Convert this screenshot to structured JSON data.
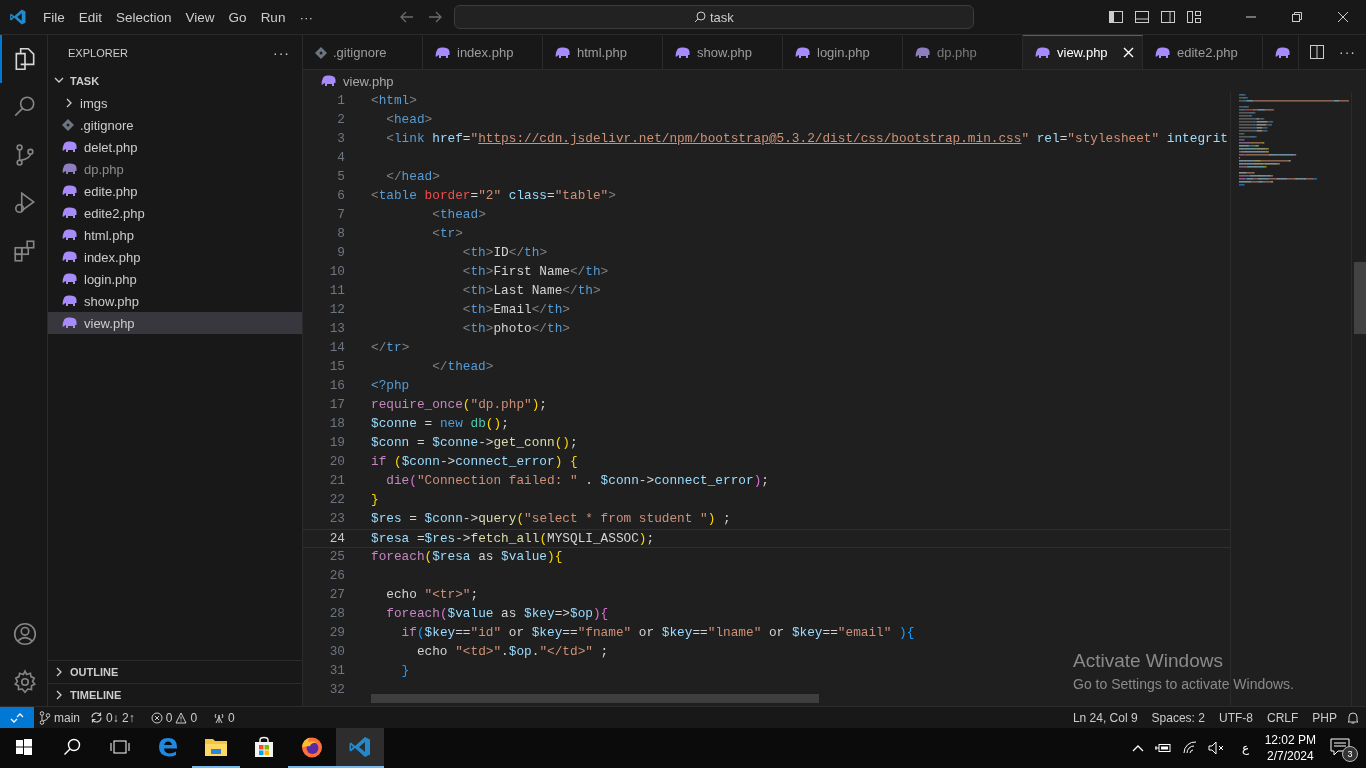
{
  "title_bar": {
    "menu": [
      "File",
      "Edit",
      "Selection",
      "View",
      "Go",
      "Run",
      "···"
    ],
    "search": {
      "value": "task"
    }
  },
  "activity_bar": {
    "top": [
      {
        "kind": "files",
        "selected": true
      },
      {
        "kind": "search",
        "selected": false
      },
      {
        "kind": "source-control",
        "selected": false
      },
      {
        "kind": "run-debug",
        "selected": false
      },
      {
        "kind": "extensions",
        "selected": false
      }
    ],
    "bottom": [
      {
        "kind": "account",
        "selected": false
      },
      {
        "kind": "gear",
        "selected": false
      }
    ]
  },
  "explorer": {
    "title": "EXPLORER",
    "more": "···",
    "folder": "TASK",
    "expanded": true,
    "files": [
      {
        "kind": "folder",
        "name": "imgs",
        "dimmed": false,
        "selected": false
      },
      {
        "kind": "gitignore",
        "name": ".gitignore",
        "dimmed": false,
        "selected": false
      },
      {
        "kind": "php",
        "name": "delet.php",
        "dimmed": false,
        "selected": false
      },
      {
        "kind": "php",
        "name": "dp.php",
        "dimmed": true,
        "selected": false
      },
      {
        "kind": "php",
        "name": "edite.php",
        "dimmed": false,
        "selected": false
      },
      {
        "kind": "php",
        "name": "edite2.php",
        "dimmed": false,
        "selected": false
      },
      {
        "kind": "php",
        "name": "html.php",
        "dimmed": false,
        "selected": false
      },
      {
        "kind": "php",
        "name": "index.php",
        "dimmed": false,
        "selected": false
      },
      {
        "kind": "php",
        "name": "login.php",
        "dimmed": false,
        "selected": false
      },
      {
        "kind": "php",
        "name": "show.php",
        "dimmed": false,
        "selected": false
      },
      {
        "kind": "php",
        "name": "view.php",
        "dimmed": false,
        "selected": true
      }
    ],
    "sections": [
      "OUTLINE",
      "TIMELINE"
    ]
  },
  "tabs": [
    {
      "kind": "gitignore",
      "label": ".gitignore",
      "dimmed": false,
      "selected": false
    },
    {
      "kind": "php",
      "label": "index.php",
      "dimmed": false,
      "selected": false
    },
    {
      "kind": "php",
      "label": "html.php",
      "dimmed": false,
      "selected": false
    },
    {
      "kind": "php",
      "label": "show.php",
      "dimmed": false,
      "selected": false
    },
    {
      "kind": "php",
      "label": "login.php",
      "dimmed": false,
      "selected": false
    },
    {
      "kind": "php",
      "label": "dp.php",
      "dimmed": true,
      "selected": false
    },
    {
      "kind": "php",
      "label": "view.php",
      "dimmed": false,
      "selected": true
    },
    {
      "kind": "php",
      "label": "edite2.php",
      "dimmed": false,
      "selected": false
    },
    {
      "kind": "php",
      "dimmed": false,
      "selected": false
    }
  ],
  "breadcrumb": "view.php",
  "editor": {
    "lines": [
      {
        "number": "1",
        "current": false,
        "tokens": [
          {
            "kind": "punct",
            "text": "<"
          },
          {
            "kind": "tag",
            "text": "html"
          },
          {
            "kind": "punct",
            "text": ">"
          }
        ]
      },
      {
        "number": "2",
        "current": false,
        "tokens": [
          {
            "kind": "punct",
            "text": "  <"
          },
          {
            "kind": "tag",
            "text": "head"
          },
          {
            "kind": "punct",
            "text": ">"
          }
        ]
      },
      {
        "number": "3",
        "current": false,
        "tokens": [
          {
            "kind": "punct",
            "text": "  <"
          },
          {
            "kind": "tag",
            "text": "link"
          },
          {
            "kind": "attr",
            "text": " href"
          },
          {
            "kind": "text",
            "text": "="
          },
          {
            "kind": "str",
            "text": "\""
          },
          {
            "kind": "link",
            "text": "https://cdn.jsdelivr.net/npm/bootstrap@5.3.2/dist/css/bootstrap.min.css"
          },
          {
            "kind": "str",
            "text": "\""
          },
          {
            "kind": "attr",
            "text": " rel"
          },
          {
            "kind": "text",
            "text": "="
          },
          {
            "kind": "str",
            "text": "\"stylesheet\""
          },
          {
            "kind": "attr",
            "text": " integrit"
          }
        ]
      },
      {
        "number": "4",
        "current": false
      },
      {
        "number": "5",
        "current": false,
        "tokens": [
          {
            "kind": "punct",
            "text": "  </"
          },
          {
            "kind": "tag",
            "text": "head"
          },
          {
            "kind": "punct",
            "text": ">"
          }
        ]
      },
      {
        "number": "6",
        "current": false,
        "tokens": [
          {
            "kind": "punct",
            "text": "<"
          },
          {
            "kind": "tag",
            "text": "table"
          },
          {
            "kind": "attrred",
            "text": " border"
          },
          {
            "kind": "text",
            "text": "="
          },
          {
            "kind": "str",
            "text": "\"2\""
          },
          {
            "kind": "attr",
            "text": " class"
          },
          {
            "kind": "text",
            "text": "="
          },
          {
            "kind": "str",
            "text": "\"table\""
          },
          {
            "kind": "punct",
            "text": ">"
          }
        ]
      },
      {
        "number": "7",
        "current": false,
        "tokens": [
          {
            "kind": "punct",
            "text": "        <"
          },
          {
            "kind": "tag",
            "text": "thead"
          },
          {
            "kind": "punct",
            "text": ">"
          }
        ]
      },
      {
        "number": "8",
        "current": false,
        "tokens": [
          {
            "kind": "punct",
            "text": "        <"
          },
          {
            "kind": "tag",
            "text": "tr"
          },
          {
            "kind": "punct",
            "text": ">"
          }
        ]
      },
      {
        "number": "9",
        "current": false,
        "tokens": [
          {
            "kind": "punct",
            "text": "            <"
          },
          {
            "kind": "tag",
            "text": "th"
          },
          {
            "kind": "punct",
            "text": ">"
          },
          {
            "kind": "text",
            "text": "ID"
          },
          {
            "kind": "punct",
            "text": "</"
          },
          {
            "kind": "tag",
            "text": "th"
          },
          {
            "kind": "punct",
            "text": ">"
          }
        ]
      },
      {
        "number": "10",
        "current": false,
        "tokens": [
          {
            "kind": "punct",
            "text": "            <"
          },
          {
            "kind": "tag",
            "text": "th"
          },
          {
            "kind": "punct",
            "text": ">"
          },
          {
            "kind": "text",
            "text": "First Name"
          },
          {
            "kind": "punct",
            "text": "</"
          },
          {
            "kind": "tag",
            "text": "th"
          },
          {
            "kind": "punct",
            "text": ">"
          }
        ]
      },
      {
        "number": "11",
        "current": false,
        "tokens": [
          {
            "kind": "punct",
            "text": "            <"
          },
          {
            "kind": "tag",
            "text": "th"
          },
          {
            "kind": "punct",
            "text": ">"
          },
          {
            "kind": "text",
            "text": "Last Name"
          },
          {
            "kind": "punct",
            "text": "</"
          },
          {
            "kind": "tag",
            "text": "th"
          },
          {
            "kind": "punct",
            "text": ">"
          }
        ]
      },
      {
        "number": "12",
        "current": false,
        "tokens": [
          {
            "kind": "punct",
            "text": "            <"
          },
          {
            "kind": "tag",
            "text": "th"
          },
          {
            "kind": "punct",
            "text": ">"
          },
          {
            "kind": "text",
            "text": "Email"
          },
          {
            "kind": "punct",
            "text": "</"
          },
          {
            "kind": "tag",
            "text": "th"
          },
          {
            "kind": "punct",
            "text": ">"
          }
        ]
      },
      {
        "number": "13",
        "current": false,
        "tokens": [
          {
            "kind": "punct",
            "text": "            <"
          },
          {
            "kind": "tag",
            "text": "th"
          },
          {
            "kind": "punct",
            "text": ">"
          },
          {
            "kind": "text",
            "text": "photo"
          },
          {
            "kind": "punct",
            "text": "</"
          },
          {
            "kind": "tag",
            "text": "th"
          },
          {
            "kind": "punct",
            "text": ">"
          }
        ]
      },
      {
        "number": "14",
        "current": false,
        "tokens": [
          {
            "kind": "punct",
            "text": "</"
          },
          {
            "kind": "tag",
            "text": "tr"
          },
          {
            "kind": "punct",
            "text": ">"
          }
        ]
      },
      {
        "number": "15",
        "current": false,
        "tokens": [
          {
            "kind": "punct",
            "text": "        </"
          },
          {
            "kind": "tag",
            "text": "thead"
          },
          {
            "kind": "punct",
            "text": ">"
          }
        ]
      },
      {
        "number": "16",
        "current": false,
        "tokens": [
          {
            "kind": "tag",
            "text": "<?php"
          }
        ]
      },
      {
        "number": "17",
        "current": false,
        "tokens": [
          {
            "kind": "kw",
            "text": "require_once"
          },
          {
            "kind": "b1",
            "text": "("
          },
          {
            "kind": "str",
            "text": "\"dp.php\""
          },
          {
            "kind": "b1",
            "text": ")"
          },
          {
            "kind": "text",
            "text": ";"
          }
        ]
      },
      {
        "number": "18",
        "current": false,
        "tokens": [
          {
            "kind": "var",
            "text": "$conne"
          },
          {
            "kind": "text",
            "text": " = "
          },
          {
            "kind": "tag",
            "text": "new"
          },
          {
            "kind": "cls",
            "text": " db"
          },
          {
            "kind": "b1",
            "text": "()"
          },
          {
            "kind": "text",
            "text": ";"
          }
        ]
      },
      {
        "number": "19",
        "current": false,
        "tokens": [
          {
            "kind": "var",
            "text": "$conn"
          },
          {
            "kind": "text",
            "text": " = "
          },
          {
            "kind": "var",
            "text": "$conne"
          },
          {
            "kind": "text",
            "text": "->"
          },
          {
            "kind": "fn",
            "text": "get_conn"
          },
          {
            "kind": "b1",
            "text": "()"
          },
          {
            "kind": "text",
            "text": ";"
          }
        ]
      },
      {
        "number": "20",
        "current": false,
        "tokens": [
          {
            "kind": "kw",
            "text": "if"
          },
          {
            "kind": "b1",
            "text": " ("
          },
          {
            "kind": "var",
            "text": "$conn"
          },
          {
            "kind": "text",
            "text": "->"
          },
          {
            "kind": "var",
            "text": "connect_error"
          },
          {
            "kind": "b1",
            "text": ") {"
          }
        ]
      },
      {
        "number": "21",
        "current": false,
        "tokens": [
          {
            "kind": "kw",
            "text": "  die"
          },
          {
            "kind": "b2",
            "text": "("
          },
          {
            "kind": "str",
            "text": "\"Connection failed: \""
          },
          {
            "kind": "text",
            "text": " . "
          },
          {
            "kind": "var",
            "text": "$conn"
          },
          {
            "kind": "text",
            "text": "->"
          },
          {
            "kind": "var",
            "text": "connect_error"
          },
          {
            "kind": "b2",
            "text": ")"
          },
          {
            "kind": "text",
            "text": ";"
          }
        ]
      },
      {
        "number": "22",
        "current": false,
        "tokens": [
          {
            "kind": "b1",
            "text": "}"
          }
        ]
      },
      {
        "number": "23",
        "current": false,
        "tokens": [
          {
            "kind": "var",
            "text": "$res"
          },
          {
            "kind": "text",
            "text": " = "
          },
          {
            "kind": "var",
            "text": "$conn"
          },
          {
            "kind": "text",
            "text": "->"
          },
          {
            "kind": "fn",
            "text": "query"
          },
          {
            "kind": "b1",
            "text": "("
          },
          {
            "kind": "str",
            "text": "\"select * from student \""
          },
          {
            "kind": "b1",
            "text": ")"
          },
          {
            "kind": "text",
            "text": " ;"
          }
        ]
      },
      {
        "number": "24",
        "current": true,
        "tokens": [
          {
            "kind": "var",
            "text": "$resa"
          },
          {
            "kind": "text",
            "text": " ="
          },
          {
            "kind": "var",
            "text": "$res"
          },
          {
            "kind": "text",
            "text": "->"
          },
          {
            "kind": "fn",
            "text": "fetch_all"
          },
          {
            "kind": "b1",
            "text": "("
          },
          {
            "kind": "text",
            "text": "MYSQLI_ASSOC"
          },
          {
            "kind": "b1",
            "text": ")"
          },
          {
            "kind": "text",
            "text": ";"
          }
        ]
      },
      {
        "number": "25",
        "current": false,
        "tokens": [
          {
            "kind": "kw",
            "text": "foreach"
          },
          {
            "kind": "b1",
            "text": "("
          },
          {
            "kind": "var",
            "text": "$resa"
          },
          {
            "kind": "text",
            "text": " as "
          },
          {
            "kind": "var",
            "text": "$value"
          },
          {
            "kind": "b1",
            "text": ")"
          },
          {
            "kind": "b1",
            "text": "{"
          }
        ]
      },
      {
        "number": "26",
        "current": false
      },
      {
        "number": "27",
        "current": false,
        "tokens": [
          {
            "kind": "text",
            "text": "  echo "
          },
          {
            "kind": "str",
            "text": "\"<tr>\""
          },
          {
            "kind": "text",
            "text": ";"
          }
        ]
      },
      {
        "number": "28",
        "current": false,
        "tokens": [
          {
            "kind": "kw",
            "text": "  foreach"
          },
          {
            "kind": "b2",
            "text": "("
          },
          {
            "kind": "var",
            "text": "$value"
          },
          {
            "kind": "text",
            "text": " as "
          },
          {
            "kind": "var",
            "text": "$key"
          },
          {
            "kind": "text",
            "text": "=>"
          },
          {
            "kind": "var",
            "text": "$op"
          },
          {
            "kind": "b2",
            "text": ")"
          },
          {
            "kind": "b2",
            "text": "{"
          }
        ]
      },
      {
        "number": "29",
        "current": false,
        "tokens": [
          {
            "kind": "kw",
            "text": "    if"
          },
          {
            "kind": "b3",
            "text": "("
          },
          {
            "kind": "var",
            "text": "$key"
          },
          {
            "kind": "text",
            "text": "=="
          },
          {
            "kind": "str",
            "text": "\"id\""
          },
          {
            "kind": "text",
            "text": " or "
          },
          {
            "kind": "var",
            "text": "$key"
          },
          {
            "kind": "text",
            "text": "=="
          },
          {
            "kind": "str",
            "text": "\"fname\""
          },
          {
            "kind": "text",
            "text": " or "
          },
          {
            "kind": "var",
            "text": "$key"
          },
          {
            "kind": "text",
            "text": "=="
          },
          {
            "kind": "str",
            "text": "\"lname\""
          },
          {
            "kind": "text",
            "text": " or "
          },
          {
            "kind": "var",
            "text": "$key"
          },
          {
            "kind": "text",
            "text": "=="
          },
          {
            "kind": "str",
            "text": "\"email\""
          },
          {
            "kind": "b3",
            "text": " ){"
          }
        ]
      },
      {
        "number": "30",
        "current": false,
        "tokens": [
          {
            "kind": "text",
            "text": "      echo "
          },
          {
            "kind": "str",
            "text": "\"<td>\""
          },
          {
            "kind": "text",
            "text": "."
          },
          {
            "kind": "var",
            "text": "$op"
          },
          {
            "kind": "text",
            "text": "."
          },
          {
            "kind": "str",
            "text": "\"</td>\""
          },
          {
            "kind": "text",
            "text": " ;"
          }
        ]
      },
      {
        "number": "31",
        "current": false,
        "tokens": [
          {
            "kind": "b3",
            "text": "    }"
          }
        ]
      },
      {
        "number": "32",
        "current": false
      }
    ]
  },
  "activation": {
    "title": "Activate Windows",
    "message": "Go to Settings to activate Windows."
  },
  "status_bar": {
    "branch": "main",
    "sync": "0↓ 2↑",
    "errors": "0",
    "warnings": "0",
    "ports": "0",
    "right": [
      "Ln 24, Col 9",
      "Spaces: 2",
      "UTF-8",
      "CRLF",
      "PHP"
    ]
  },
  "taskbar": {
    "apps": [
      {
        "kind": "edge",
        "running": false,
        "active": false
      },
      {
        "kind": "file-explorer",
        "running": true,
        "active": false
      },
      {
        "kind": "store",
        "running": false,
        "active": false
      },
      {
        "kind": "firefox",
        "running": true,
        "active": false
      },
      {
        "kind": "vscode",
        "running": true,
        "active": true
      }
    ],
    "language": "ع",
    "time": "12:02 PM",
    "date": "2/7/2024",
    "notifications": "3"
  }
}
